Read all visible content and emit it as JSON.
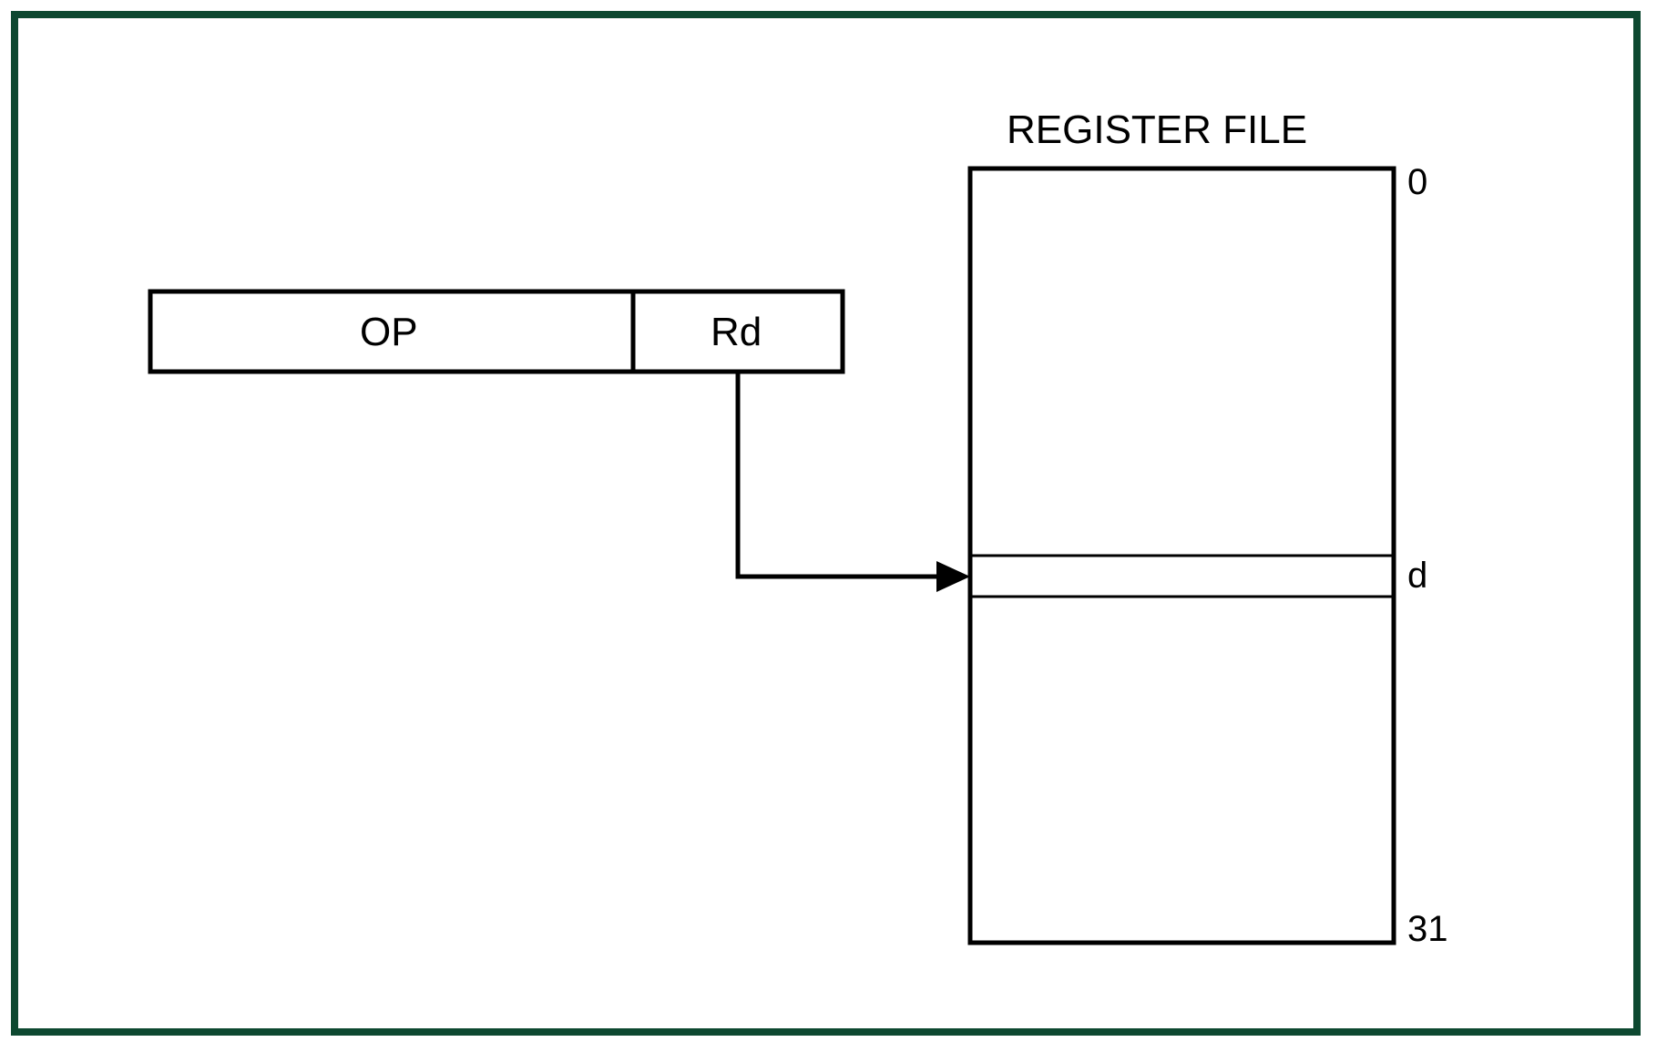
{
  "title": "REGISTER FILE",
  "instruction": {
    "op_label": "OP",
    "rd_label": "Rd"
  },
  "register_file": {
    "top_index": "0",
    "bottom_index": "31",
    "selected_label": "d"
  }
}
